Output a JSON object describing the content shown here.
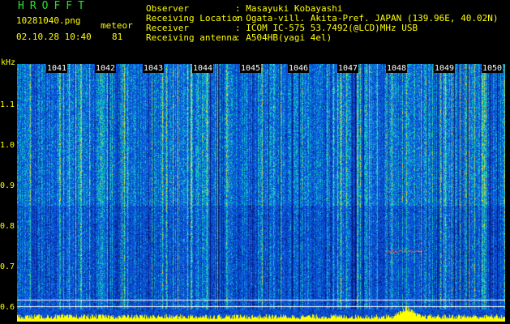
{
  "header": {
    "brand": "HROFFT",
    "filename": "10281040.png",
    "mode": "meteor",
    "datetime": "02.10.28 10:40",
    "count": "81"
  },
  "info": [
    {
      "label": "Observer",
      "value": ": Masayuki Kobayashi"
    },
    {
      "label": "Receiving Location",
      "value": ": Ogata-vill. Akita-Pref. JAPAN (139.96E, 40.02N)"
    },
    {
      "label": "Receiver",
      "value": ": ICOM IC-575 53.7492(@LCD)MHz USB"
    },
    {
      "label": "Receiving antenna",
      "value": ": A504HB(yagi 4el)"
    }
  ],
  "axis": {
    "unit": "kHz",
    "yticks": [
      "1.1",
      "1.0",
      "0.9",
      "0.8",
      "0.7",
      "0.6"
    ],
    "time_labels": [
      "1041",
      "1042",
      "1043",
      "1044",
      "1045",
      "1046",
      "1047",
      "1048",
      "1049",
      "1050"
    ]
  },
  "colors": {
    "background": "#000000",
    "text": "#ffff00",
    "brand": "#2ee02e",
    "noise_low": "#0a1a8c",
    "noise_high": "#17c4c8",
    "baseline": "#ffff00"
  }
}
